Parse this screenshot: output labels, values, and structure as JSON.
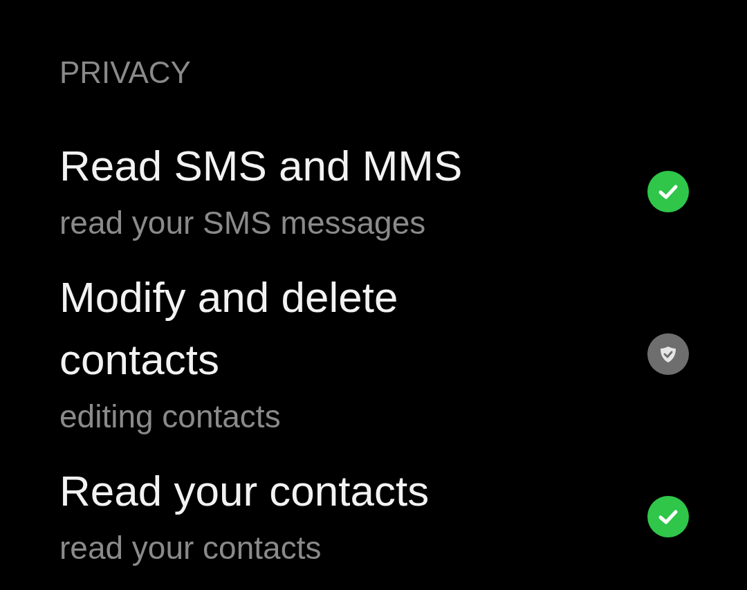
{
  "section": {
    "title": "PRIVACY"
  },
  "permissions": [
    {
      "title": "Read SMS and MMS",
      "subtitle": "read your SMS messages",
      "kind": "allowed"
    },
    {
      "title": "Modify and delete contacts",
      "subtitle": "editing contacts",
      "kind": "ask"
    },
    {
      "title": "Read your contacts",
      "subtitle": "read your contacts",
      "kind": "allowed"
    }
  ]
}
